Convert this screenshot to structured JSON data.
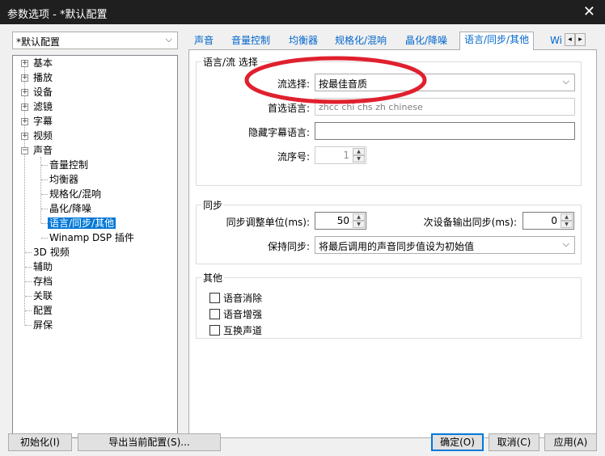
{
  "window": {
    "title": "参数选项 - *默认配置"
  },
  "profile": {
    "selected": "*默认配置"
  },
  "tree": {
    "items": [
      {
        "label": "基本",
        "expander": "+"
      },
      {
        "label": "播放",
        "expander": "+"
      },
      {
        "label": "设备",
        "expander": "+"
      },
      {
        "label": "滤镜",
        "expander": "+"
      },
      {
        "label": "字幕",
        "expander": "+"
      },
      {
        "label": "视频",
        "expander": "+"
      },
      {
        "label": "声音",
        "expander": "−"
      },
      {
        "label": "音量控制"
      },
      {
        "label": "均衡器"
      },
      {
        "label": "规格化/混响"
      },
      {
        "label": "晶化/降噪"
      },
      {
        "label": "语言/同步/其他"
      },
      {
        "label": "Winamp DSP 插件"
      },
      {
        "label": "3D 视频"
      },
      {
        "label": "辅助"
      },
      {
        "label": "存档"
      },
      {
        "label": "关联"
      },
      {
        "label": "配置"
      },
      {
        "label": "屏保"
      }
    ]
  },
  "tabs": [
    "声音",
    "音量控制",
    "均衡器",
    "规格化/混响",
    "晶化/降噪",
    "语言/同步/其他",
    "Wi"
  ],
  "tab_scroll": {
    "left": "◂",
    "right": "▸"
  },
  "lang_group": {
    "title": "语言/流 选择",
    "stream_label": "流选择:",
    "stream_value": "按最佳音质",
    "preferred_label": "首选语言:",
    "preferred_placeholder": "zhcc chi chs zh chinese",
    "hidden_sub_label": "隐藏字幕语言:",
    "hidden_sub_value": "",
    "stream_no_label": "流序号:",
    "stream_no_value": "1"
  },
  "sync_group": {
    "title": "同步",
    "unit_label": "同步调整单位(ms):",
    "unit_value": "50",
    "secondary_label": "次设备输出同步(ms):",
    "secondary_value": "0",
    "keep_label": "保持同步:",
    "keep_value": "将最后调用的声音同步值设为初始值"
  },
  "other_group": {
    "title": "其他",
    "checks": [
      "语音消除",
      "语音增强",
      "互换声道"
    ]
  },
  "buttons": {
    "init": "初始化(I)",
    "export": "导出当前配置(S)...",
    "ok": "确定(O)",
    "cancel": "取消(C)",
    "apply": "应用(A)"
  },
  "glyphs": {
    "close": "✕",
    "dropdown": "⌵",
    "up": "▲",
    "down": "▼"
  },
  "colors": {
    "accent": "#0078d7",
    "tab_text": "#0066cc",
    "annotation_red": "#e0202e"
  }
}
